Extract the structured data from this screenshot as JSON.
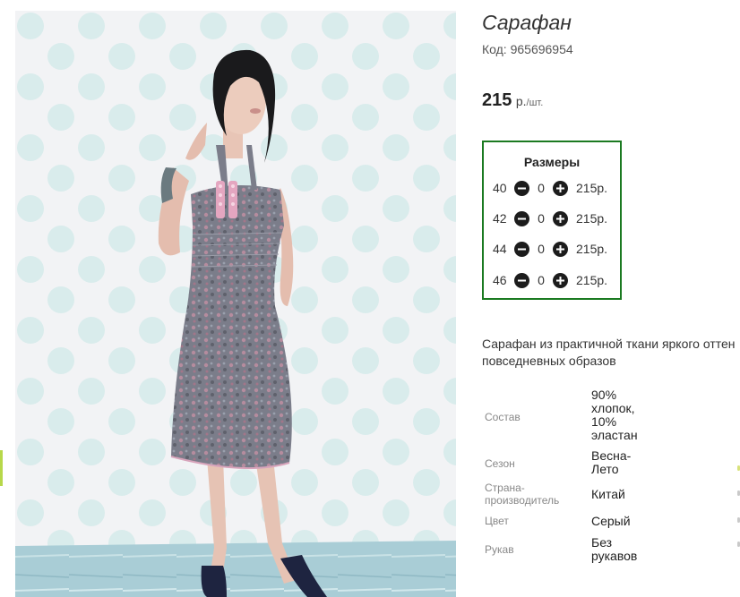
{
  "product": {
    "title": "Сарафан",
    "sku": "Код: 965696954",
    "price": "215",
    "price_currency": "р.",
    "price_per_unit": "/шт."
  },
  "sizes": {
    "title": "Размеры",
    "rows": [
      {
        "size": "40",
        "qty": "0",
        "price": "215р."
      },
      {
        "size": "42",
        "qty": "0",
        "price": "215р."
      },
      {
        "size": "44",
        "qty": "0",
        "price": "215р."
      },
      {
        "size": "46",
        "qty": "0",
        "price": "215р."
      }
    ]
  },
  "description": {
    "line1": "Сарафан из практичной ткани яркого оттен",
    "line2": "повседневных образов"
  },
  "specs": [
    {
      "label": "Состав",
      "value": [
        "90%",
        "хлопок,",
        "10%",
        "эластан"
      ]
    },
    {
      "label": [
        "Сезон"
      ],
      "value": [
        "Весна-",
        "Лето"
      ]
    },
    {
      "label": [
        "Страна-",
        "производитель"
      ],
      "value": [
        "Китай"
      ]
    },
    {
      "label": [
        "Цвет"
      ],
      "value": [
        "Серый"
      ]
    },
    {
      "label": [
        "Рукав"
      ],
      "value": [
        "Без",
        "рукавов"
      ]
    }
  ],
  "icons": {
    "minus": "minus-circle-icon",
    "plus": "plus-circle-icon"
  },
  "colors": {
    "sizes_border": "#1b7a21",
    "button": "#1c1c1c"
  }
}
